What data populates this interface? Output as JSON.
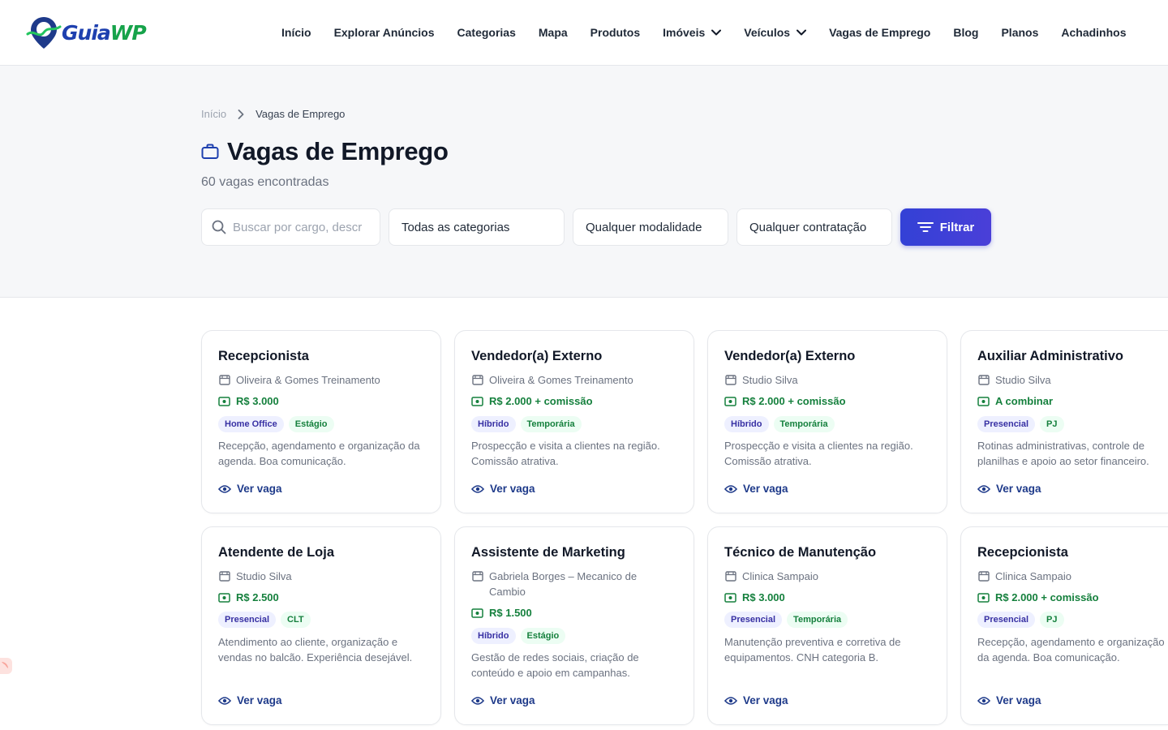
{
  "brand": {
    "part1": "Guia",
    "part2": "WP",
    "icon": "map-pin-logo-icon"
  },
  "nav": [
    {
      "label": "Início"
    },
    {
      "label": "Explorar Anúncios"
    },
    {
      "label": "Categorias"
    },
    {
      "label": "Mapa"
    },
    {
      "label": "Produtos"
    },
    {
      "label": "Imóveis",
      "dropdown": true
    },
    {
      "label": "Veículos",
      "dropdown": true
    },
    {
      "label": "Vagas de Emprego"
    },
    {
      "label": "Blog"
    },
    {
      "label": "Planos"
    },
    {
      "label": "Achadinhos"
    }
  ],
  "breadcrumb": {
    "home": "Início",
    "current": "Vagas de Emprego"
  },
  "page": {
    "title": "Vagas de Emprego",
    "count": "60 vagas encontradas",
    "title_icon": "briefcase-icon"
  },
  "filters": {
    "search_placeholder": "Buscar por cargo, descrição...",
    "category": "Todas as categorias",
    "modality": "Qualquer modalidade",
    "contract": "Qualquer contratação",
    "button": "Filtrar"
  },
  "colors": {
    "accent": "#3341d6",
    "salary": "#15803d",
    "link": "#1e3a8a"
  },
  "jobs": [
    {
      "title": "Recepcionista",
      "company": "Oliveira & Gomes Treinamento",
      "salary": "R$ 3.000",
      "modality": "Home Office",
      "contract": "Estágio",
      "description": "Recepção, agendamento e organização da agenda. Boa comunicação.",
      "link": "Ver vaga"
    },
    {
      "title": "Vendedor(a) Externo",
      "company": "Oliveira & Gomes Treinamento",
      "salary": "R$ 2.000 + comissão",
      "modality": "Híbrido",
      "contract": "Temporária",
      "description": "Prospecção e visita a clientes na região. Comissão atrativa.",
      "link": "Ver vaga"
    },
    {
      "title": "Vendedor(a) Externo",
      "company": "Studio Silva",
      "salary": "R$ 2.000 + comissão",
      "modality": "Híbrido",
      "contract": "Temporária",
      "description": "Prospecção e visita a clientes na região. Comissão atrativa.",
      "link": "Ver vaga"
    },
    {
      "title": "Auxiliar Administrativo",
      "company": "Studio Silva",
      "salary": "A combinar",
      "modality": "Presencial",
      "contract": "PJ",
      "description": "Rotinas administrativas, controle de planilhas e apoio ao setor financeiro.",
      "link": "Ver vaga"
    },
    {
      "title": "Atendente de Loja",
      "company": "Studio Silva",
      "salary": "R$ 2.500",
      "modality": "Presencial",
      "contract": "CLT",
      "description": "Atendimento ao cliente, organização e vendas no balcão. Experiência desejável.",
      "link": "Ver vaga"
    },
    {
      "title": "Assistente de Marketing",
      "company": "Gabriela Borges – Mecanico de Cambio",
      "salary": "R$ 1.500",
      "modality": "Híbrido",
      "contract": "Estágio",
      "description": "Gestão de redes sociais, criação de conteúdo e apoio em campanhas.",
      "link": "Ver vaga"
    },
    {
      "title": "Técnico de Manutenção",
      "company": "Clinica Sampaio",
      "salary": "R$ 3.000",
      "modality": "Presencial",
      "contract": "Temporária",
      "description": "Manutenção preventiva e corretiva de equipamentos. CNH categoria B.",
      "link": "Ver vaga"
    },
    {
      "title": "Recepcionista",
      "company": "Clinica Sampaio",
      "salary": "R$ 2.000 + comissão",
      "modality": "Presencial",
      "contract": "PJ",
      "description": "Recepção, agendamento e organização da agenda. Boa comunicação.",
      "link": "Ver vaga"
    }
  ]
}
